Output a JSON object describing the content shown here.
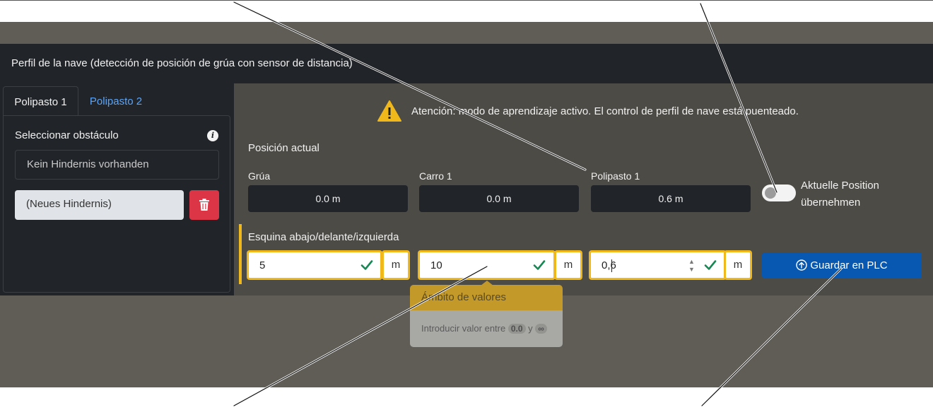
{
  "header": {
    "title": "Perfil de la nave (detección de posición de grúa con sensor de distancia)"
  },
  "tabs": [
    {
      "label": "Polipasto 1",
      "active": true
    },
    {
      "label": "Polipasto 2",
      "active": false
    }
  ],
  "obstacles": {
    "label": "Seleccionar obstáculo",
    "info_icon": "i",
    "items": [
      "Kein Hindernis vorhanden"
    ],
    "new_value": "(Neues Hindernis)",
    "delete_icon": "trash-icon"
  },
  "warning": {
    "icon": "warning-triangle-icon",
    "text": "Atención: modo de aprendizaje activo. El control de perfil de nave está puenteado."
  },
  "position": {
    "title": "Posición actual",
    "fields": [
      {
        "label": "Grúa",
        "value": "0.0 m"
      },
      {
        "label": "Carro 1",
        "value": "0.0 m"
      },
      {
        "label": "Polipasto 1",
        "value": "0.6 m"
      }
    ]
  },
  "toggle": {
    "label": "Aktuelle Position übernehmen",
    "on": false
  },
  "corner": {
    "title": "Esquina abajo/delante/izquierda",
    "inputs": [
      {
        "value": "5",
        "unit": "m"
      },
      {
        "value": "10",
        "unit": "m"
      },
      {
        "value": "0,6",
        "unit": "m"
      }
    ]
  },
  "save_button": {
    "label": "Guardar en PLC",
    "icon": "upload-icon"
  },
  "tooltip": {
    "title": "Ámbito de valores",
    "text_prefix": "Introducir valor entre",
    "min": "0.0",
    "conj": "y",
    "max": "∞"
  },
  "colors": {
    "accent_yellow": "#f0b81b",
    "primary_blue": "#0858b1",
    "danger_red": "#dc3545",
    "check_green": "#198754"
  }
}
